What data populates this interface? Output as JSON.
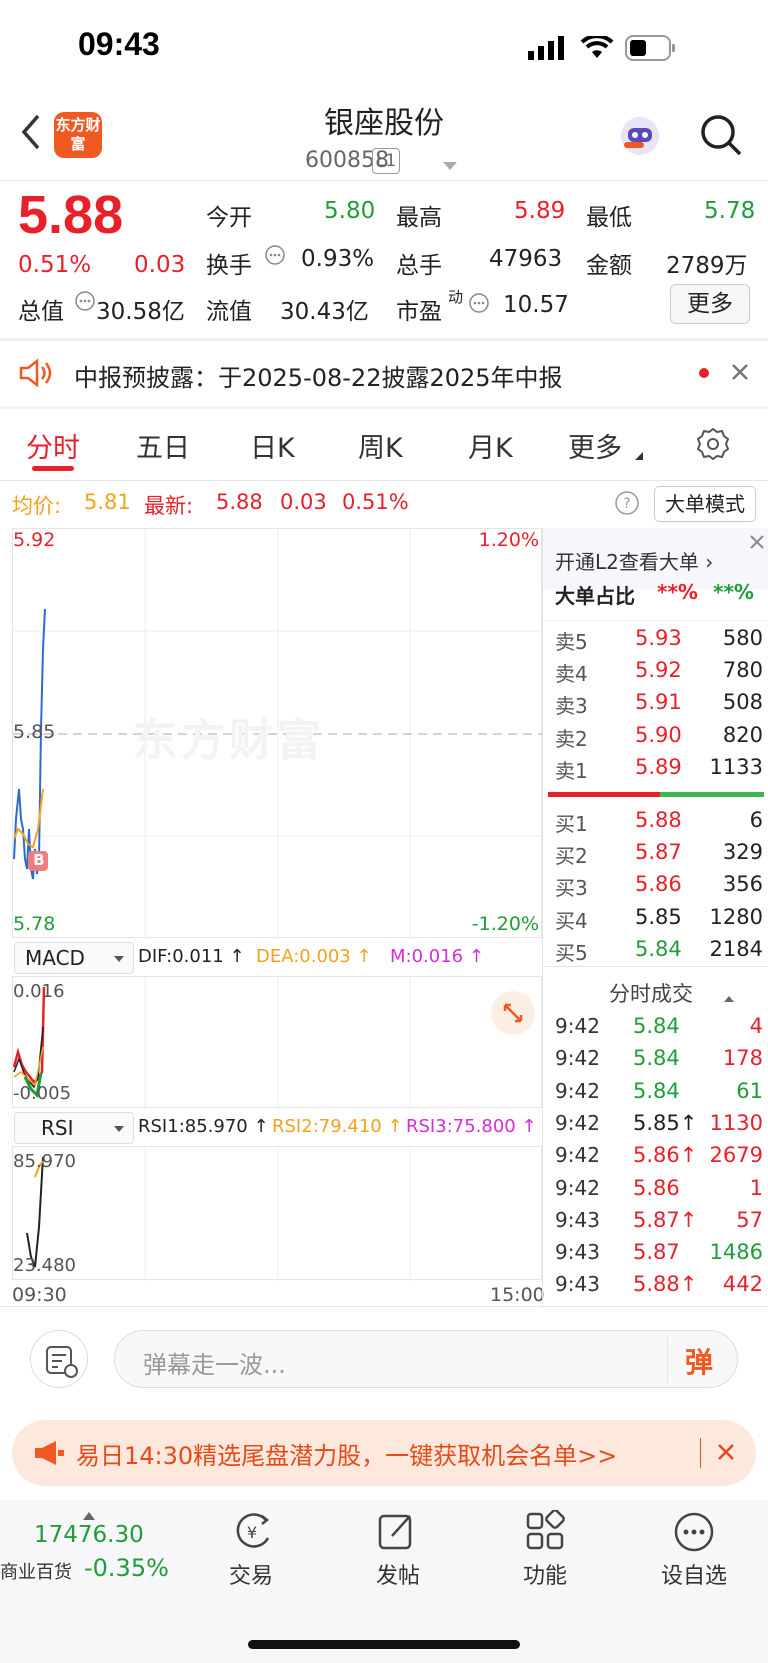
{
  "status_bar": {
    "time": "09:43"
  },
  "header": {
    "logo_text": "东方财富",
    "title": "银座股份",
    "code": "600858",
    "level": "L1"
  },
  "quote": {
    "price": "5.88",
    "change_pct": "0.51%",
    "change": "0.03",
    "open_label": "今开",
    "open": "5.80",
    "high_label": "最高",
    "high": "5.89",
    "low_label": "最低",
    "low": "5.78",
    "turnover_label": "换手",
    "turnover": "0.93%",
    "volume_label": "总手",
    "volume": "47963",
    "amount_label": "金额",
    "amount": "2789万",
    "mcap_label": "总值",
    "mcap": "30.58亿",
    "float_label": "流值",
    "float": "30.43亿",
    "pe_label": "市盈",
    "pe_sup": "动",
    "pe": "10.57",
    "more": "更多"
  },
  "notice": {
    "text": "中报预披露：于2025-08-22披露2025年中报"
  },
  "tabs": [
    "分时",
    "五日",
    "日K",
    "周K",
    "月K",
    "更多"
  ],
  "chart_header": {
    "avg_label": "均价:",
    "avg": "5.81",
    "latest_label": "最新:",
    "latest": "5.88",
    "latest_change": "0.03",
    "latest_pct": "0.51%",
    "mode_button": "大单模式"
  },
  "main_chart": {
    "ymax": "5.92",
    "ymid": "5.85",
    "ymin": "5.78",
    "pmax": "1.20%",
    "pmin": "-1.20%",
    "watermark": "东方财富",
    "b_marker": "B",
    "start_time": "09:30",
    "end_time": "15:00"
  },
  "macd": {
    "label": "MACD",
    "dif": "DIF:0.011 ↑",
    "dea": "DEA:0.003 ↑",
    "m": "M:0.016 ↑",
    "ymax": "0.016",
    "ymin": "-0.005"
  },
  "rsi": {
    "label": "RSI",
    "rsi1": "RSI1:85.970 ↑",
    "rsi2": "RSI2:79.410 ↑",
    "rsi3": "RSI3:75.800 ↑",
    "ymax": "85.970",
    "ymin": "23.480"
  },
  "order_book": {
    "l2_promo": "开通L2查看大单 ›",
    "big_ratio_label": "大单占比",
    "big_ratio_sell": "**%",
    "big_ratio_buy": "**%",
    "asks": [
      {
        "label": "卖5",
        "price": "5.93",
        "vol": "580",
        "color": "red"
      },
      {
        "label": "卖4",
        "price": "5.92",
        "vol": "780",
        "color": "red"
      },
      {
        "label": "卖3",
        "price": "5.91",
        "vol": "508",
        "color": "red"
      },
      {
        "label": "卖2",
        "price": "5.90",
        "vol": "820",
        "color": "red"
      },
      {
        "label": "卖1",
        "price": "5.89",
        "vol": "1133",
        "color": "red"
      }
    ],
    "bids": [
      {
        "label": "买1",
        "price": "5.88",
        "vol": "6",
        "color": "red"
      },
      {
        "label": "买2",
        "price": "5.87",
        "vol": "329",
        "color": "red"
      },
      {
        "label": "买3",
        "price": "5.86",
        "vol": "356",
        "color": "red"
      },
      {
        "label": "买4",
        "price": "5.85",
        "vol": "1280",
        "color": "black"
      },
      {
        "label": "买5",
        "price": "5.84",
        "vol": "2184",
        "color": "green"
      }
    ],
    "sell_buy_ratio": 0.52
  },
  "ticks": {
    "title": "分时成交",
    "rows": [
      {
        "time": "9:42",
        "price": "5.84",
        "pcolor": "green",
        "vol": "4",
        "vcolor": "red"
      },
      {
        "time": "9:42",
        "price": "5.84",
        "pcolor": "green",
        "vol": "178",
        "vcolor": "red"
      },
      {
        "time": "9:42",
        "price": "5.84",
        "pcolor": "green",
        "vol": "61",
        "vcolor": "green"
      },
      {
        "time": "9:42",
        "price": "5.85↑",
        "pcolor": "black",
        "vol": "1130",
        "vcolor": "red"
      },
      {
        "time": "9:42",
        "price": "5.86↑",
        "pcolor": "red",
        "vol": "2679",
        "vcolor": "red"
      },
      {
        "time": "9:42",
        "price": "5.86",
        "pcolor": "red",
        "vol": "1",
        "vcolor": "red"
      },
      {
        "time": "9:43",
        "price": "5.87↑",
        "pcolor": "red",
        "vol": "57",
        "vcolor": "red"
      },
      {
        "time": "9:43",
        "price": "5.87",
        "pcolor": "red",
        "vol": "1486",
        "vcolor": "green"
      },
      {
        "time": "9:43",
        "price": "5.88↑",
        "pcolor": "red",
        "vol": "442",
        "vcolor": "red"
      }
    ]
  },
  "comment_bar": {
    "placeholder": "弹幕走一波...",
    "danmu_icon": "弹"
  },
  "ad_banner": {
    "text": "易日14:30精选尾盘潜力股，一键获取机会名单>>"
  },
  "bottom_nav": {
    "index_value": "17476.30",
    "index_name": "商业百货",
    "index_change": "-0.35%",
    "items": [
      "交易",
      "发帖",
      "功能",
      "设自选"
    ]
  },
  "colors": {
    "up": "#e8202a",
    "down": "#1f9d38",
    "brand": "#f05a22"
  }
}
